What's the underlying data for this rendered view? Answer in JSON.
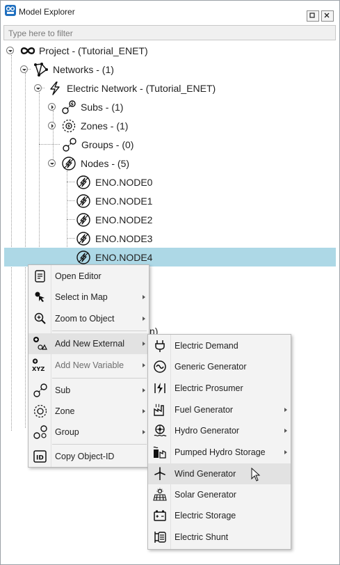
{
  "window": {
    "title": "Model Explorer",
    "filter_placeholder": "Type here to filter"
  },
  "tree": {
    "project": "Project - (Tutorial_ENET)",
    "networks": "Networks - (1)",
    "electric_network": "Electric Network - (Tutorial_ENET)",
    "subs": "Subs - (1)",
    "zones": "Zones - (1)",
    "groups": "Groups - (0)",
    "nodes": "Nodes - (5)",
    "node_items": [
      "ENO.NODE0",
      "ENO.NODE1",
      "ENO.NODE2",
      "ENO.NODE3",
      "ENO.NODE4"
    ],
    "selected_item": "ENO.NODE4",
    "partial_hidden_text": "n)"
  },
  "context_menu": {
    "items": [
      {
        "label": "Open Editor",
        "icon": "editor-icon",
        "submenu": false
      },
      {
        "label": "Select in Map",
        "icon": "cursor-select-icon",
        "submenu": true
      },
      {
        "label": "Zoom to Object",
        "icon": "zoom-icon",
        "submenu": true
      },
      {
        "label": "Add New External",
        "icon": "add-external-icon",
        "submenu": true
      },
      {
        "label": "Add New Variable",
        "icon": "add-variable-icon",
        "submenu": true
      },
      {
        "label": "Sub",
        "icon": "sub-icon",
        "submenu": true
      },
      {
        "label": "Zone",
        "icon": "zone-icon",
        "submenu": true
      },
      {
        "label": "Group",
        "icon": "group-icon",
        "submenu": true
      },
      {
        "label": "Copy Object-ID",
        "icon": "id-icon",
        "submenu": false
      }
    ]
  },
  "submenu": {
    "items": [
      {
        "label": "Electric Demand",
        "icon": "plug-icon",
        "submenu": false
      },
      {
        "label": "Generic Generator",
        "icon": "generator-icon",
        "submenu": false
      },
      {
        "label": "Electric Prosumer",
        "icon": "prosumer-icon",
        "submenu": false
      },
      {
        "label": "Fuel Generator",
        "icon": "factory-icon",
        "submenu": true
      },
      {
        "label": "Hydro Generator",
        "icon": "turbine-icon",
        "submenu": true
      },
      {
        "label": "Pumped Hydro Storage",
        "icon": "pumped-hydro-icon",
        "submenu": true
      },
      {
        "label": "Wind Generator",
        "icon": "wind-turbine-icon",
        "submenu": false
      },
      {
        "label": "Solar Generator",
        "icon": "solar-panel-icon",
        "submenu": false
      },
      {
        "label": "Electric Storage",
        "icon": "battery-icon",
        "submenu": false
      },
      {
        "label": "Electric Shunt",
        "icon": "shunt-icon",
        "submenu": false
      }
    ],
    "hovered": "Wind Generator"
  },
  "colors": {
    "selection": "#add8e6",
    "menu_bg": "#f3f3f3",
    "hover": "#e2e2e2",
    "brand": "#1f6fbf"
  }
}
